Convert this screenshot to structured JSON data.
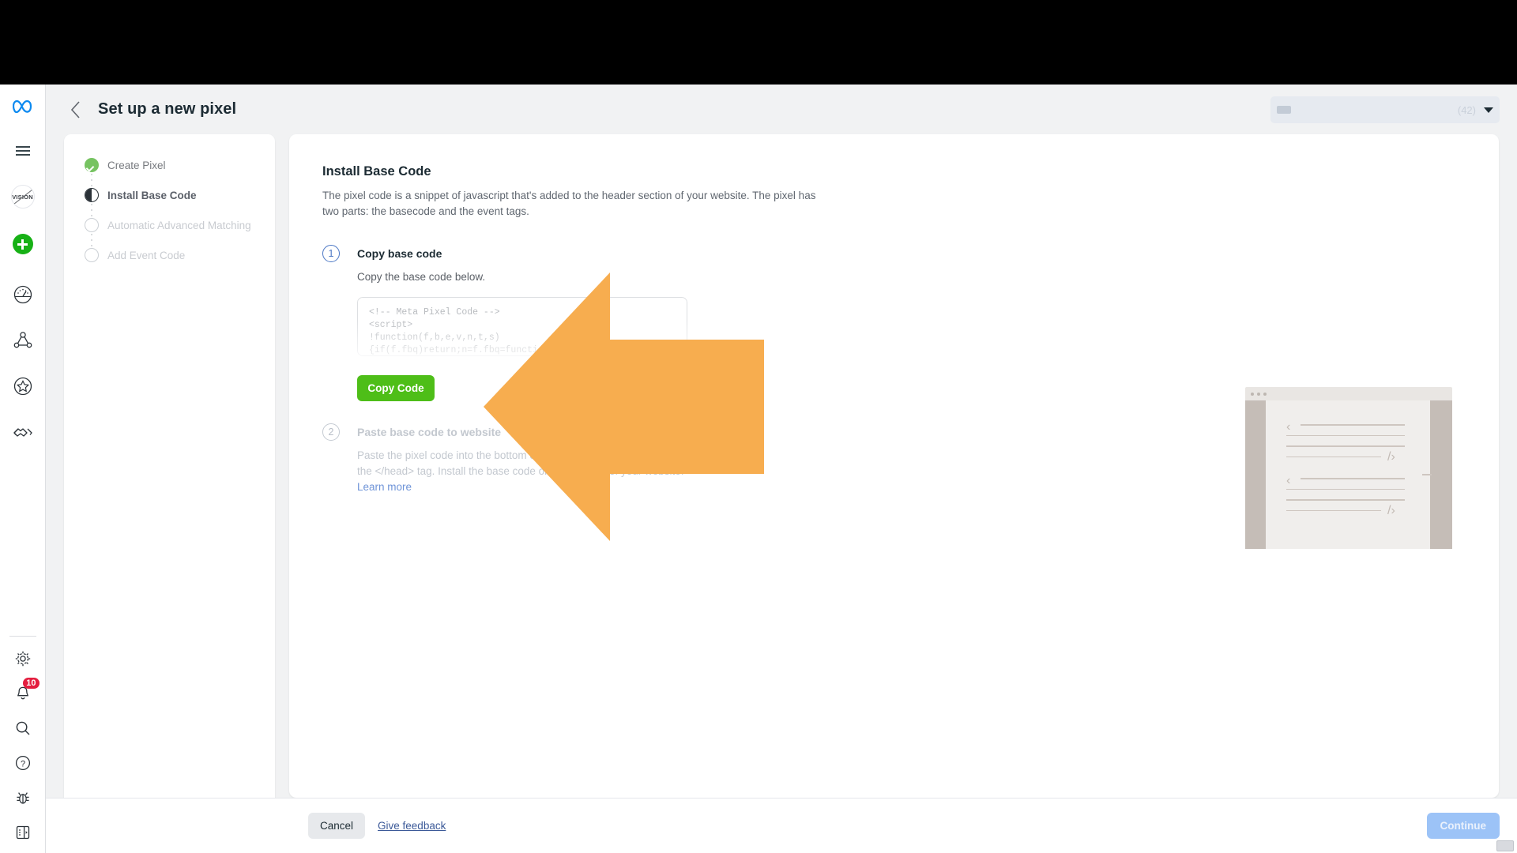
{
  "header": {
    "title": "Set up a new pixel",
    "back_icon": "chevron-left-icon",
    "account_select": {
      "value": "",
      "count": "(42)",
      "caret_icon": "chevron-down-icon"
    }
  },
  "rail": {
    "top_icons": [
      {
        "name": "meta-logo-icon",
        "label": "Meta"
      },
      {
        "name": "hamburger-menu-icon",
        "label": "Menu"
      },
      {
        "name": "vision-avatar",
        "label": "VISION"
      },
      {
        "name": "create-plus-icon",
        "label": "Create"
      },
      {
        "name": "gauge-icon",
        "label": "Performance"
      },
      {
        "name": "graph-network-icon",
        "label": "Audiences"
      },
      {
        "name": "star-badge-icon",
        "label": "Favorites"
      },
      {
        "name": "handshake-icon",
        "label": "Partnerships"
      }
    ],
    "bottom_icons": [
      {
        "name": "gear-icon",
        "label": "Settings"
      },
      {
        "name": "bell-icon",
        "label": "Notifications",
        "badge": "10"
      },
      {
        "name": "search-icon",
        "label": "Search"
      },
      {
        "name": "help-circle-icon",
        "label": "Help"
      },
      {
        "name": "bug-icon",
        "label": "Report a bug"
      },
      {
        "name": "collapse-panel-icon",
        "label": "Collapse"
      }
    ]
  },
  "steps": [
    {
      "label": "Create Pixel",
      "state": "done",
      "icon": "check-circle-icon"
    },
    {
      "label": "Install Base Code",
      "state": "current",
      "icon": "half-circle-icon"
    },
    {
      "label": "Automatic Advanced Matching",
      "state": "todo",
      "icon": "empty-circle-icon"
    },
    {
      "label": "Add Event Code",
      "state": "todo",
      "icon": "empty-circle-icon"
    }
  ],
  "main": {
    "title": "Install Base Code",
    "description": "The pixel code is a snippet of javascript that's added to the header section of your website. The pixel has two parts: the basecode and the event tags.",
    "step1": {
      "number": "1",
      "heading": "Copy base code",
      "sub": "Copy the base code below.",
      "code": "<!-- Meta Pixel Code -->\n<script>\n!function(f,b,e,v,n,t,s)\n{if(f.fbq)return;n=f.fbq=function(\nn.callMethod.apply(n,arguments)",
      "copy_label": "Copy Code"
    },
    "step2": {
      "number": "2",
      "heading": "Paste base code to website",
      "sub": "Paste the pixel code into the bottom of the header section just above the </head> tag. Install the base code on every page of your website.",
      "link_label": "Learn more"
    },
    "illustration": {
      "name": "website-code-mockup",
      "bracket_open": "‹",
      "bracket_close": "/›"
    }
  },
  "footer": {
    "cancel_label": "Cancel",
    "feedback_label": "Give feedback",
    "continue_label": "Continue"
  },
  "annotation": {
    "name": "orange-left-arrow-pointing-to-copy-code",
    "color": "#f7ad4f"
  },
  "colors": {
    "accent_green": "#4ebe18",
    "link_blue": "#3b5998",
    "continue_disabled": "#9cc3f7",
    "badge_red": "#e41e3f",
    "step_done_green": "#76c361"
  }
}
